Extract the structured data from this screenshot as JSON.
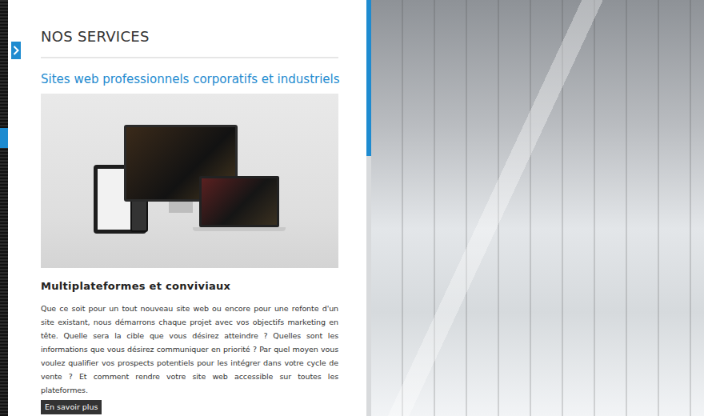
{
  "section": {
    "title": "NOS SERVICES",
    "subtitle": "Sites web professionnels corporatifs et industriels",
    "heading": "Multiplateformes et conviviaux",
    "body": "Que ce soit pour un tout nouveau site web ou encore pour une refonte d'un site existant, nous démarrons chaque projet avec vos objectifs marketing en tête. Quelle sera la cible que vous désirez atteindre ? Quelles sont les informations que vous désirez communiquer en priorité ? Par quel moyen vous voulez qualifier vos prospects potentiels pour les intégrer dans votre cycle de vente ? Et comment rendre votre site web accessible sur toutes les plateformes.",
    "button": "En savoir plus"
  }
}
